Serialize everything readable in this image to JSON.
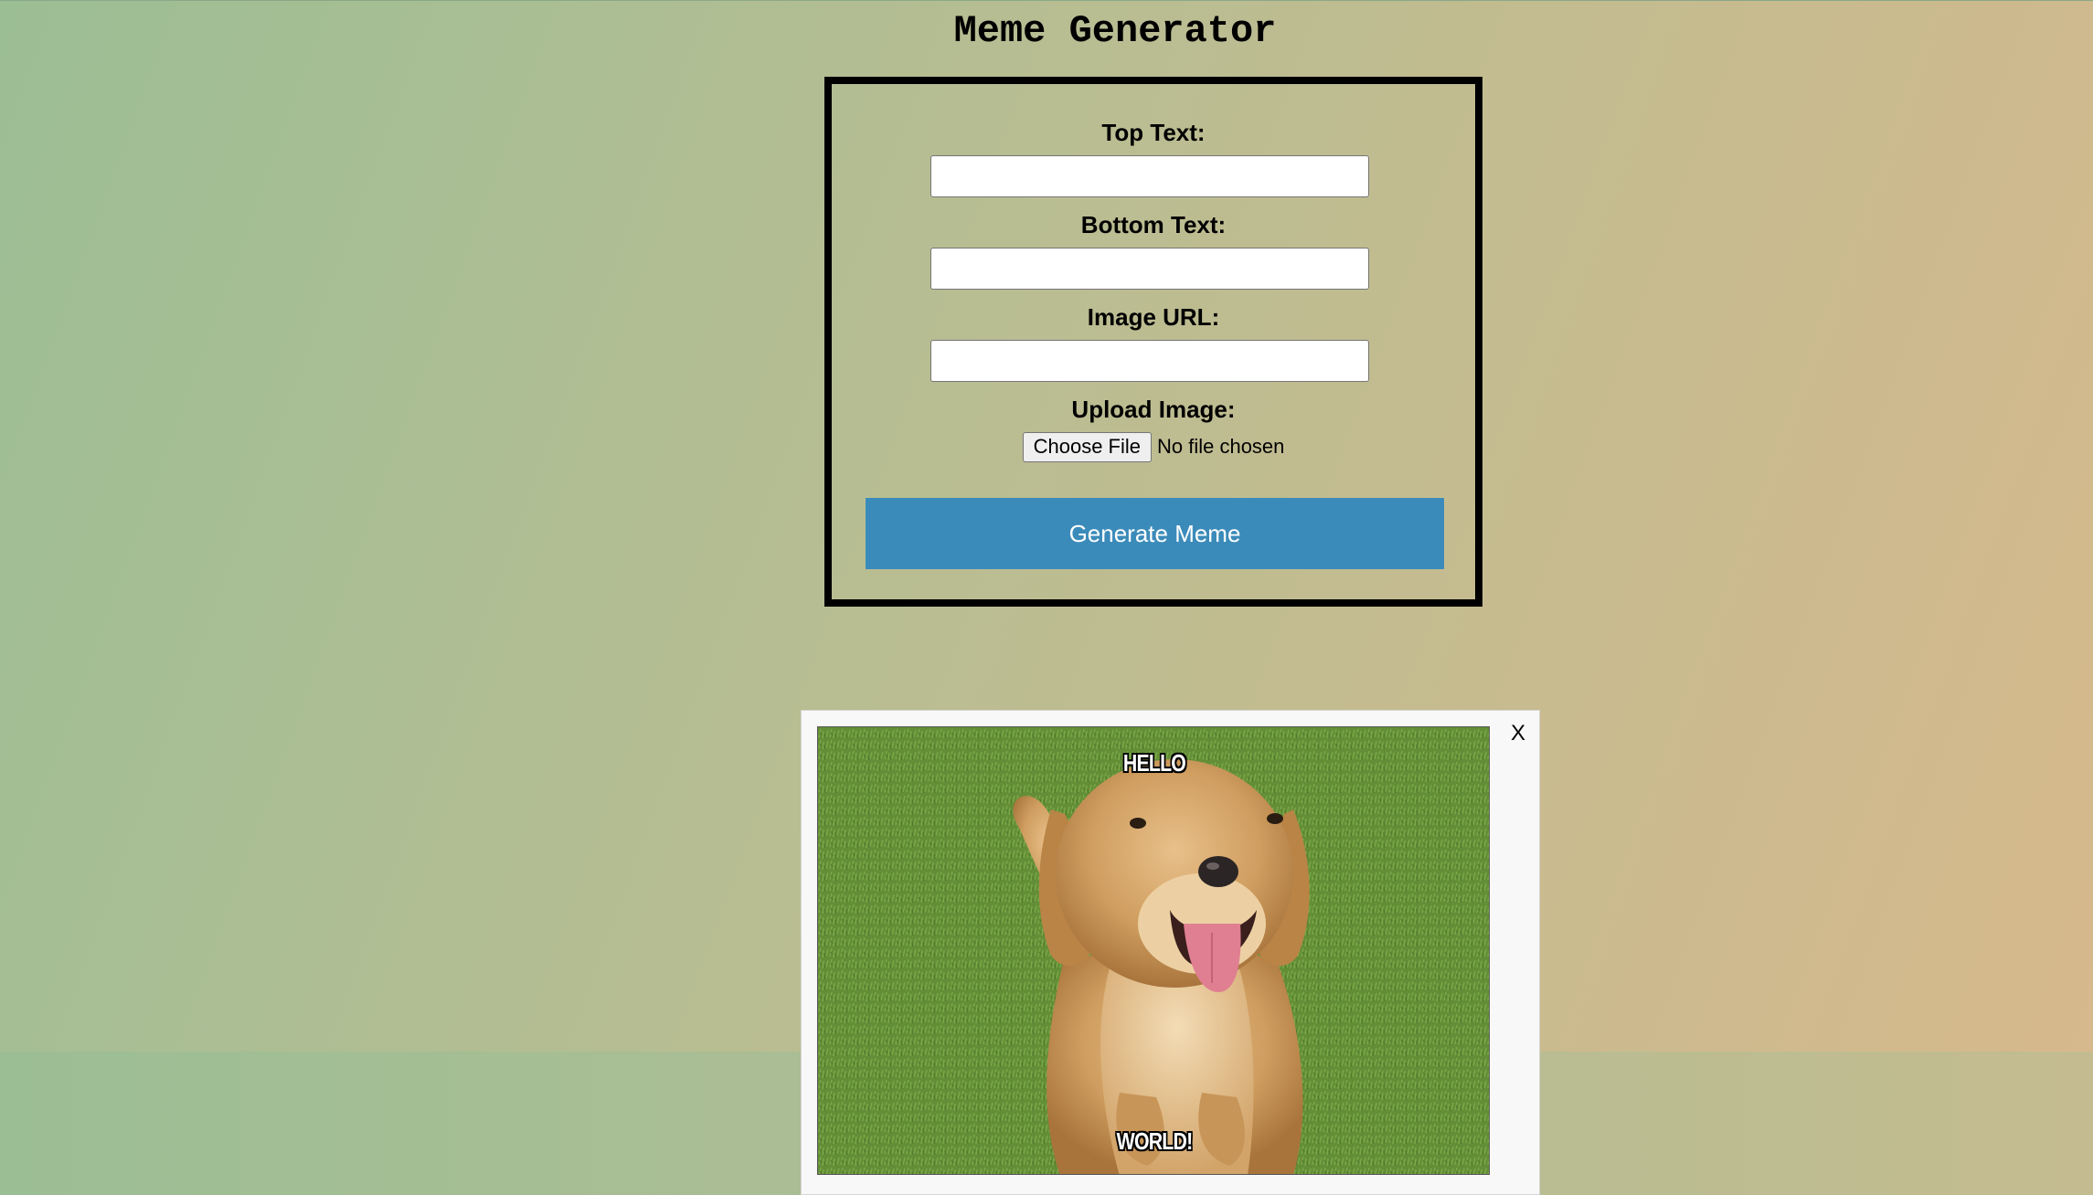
{
  "page": {
    "title": "Meme Generator"
  },
  "form": {
    "top_text_label": "Top Text:",
    "top_text_value": "",
    "bottom_text_label": "Bottom Text:",
    "bottom_text_value": "",
    "image_url_label": "Image URL:",
    "image_url_value": "",
    "upload_label": "Upload Image:",
    "file_button_label": "Choose File",
    "file_status": "No file chosen",
    "generate_label": "Generate Meme"
  },
  "meme_modal": {
    "close_label": "X",
    "top_text": "HELLO",
    "bottom_text": "WORLD!",
    "image_icon": "golden-retriever-photo"
  },
  "colors": {
    "generate_button": "#3b8bba",
    "form_border": "#000000",
    "background_start": "#9cbe95",
    "background_end": "#d6b98c"
  }
}
